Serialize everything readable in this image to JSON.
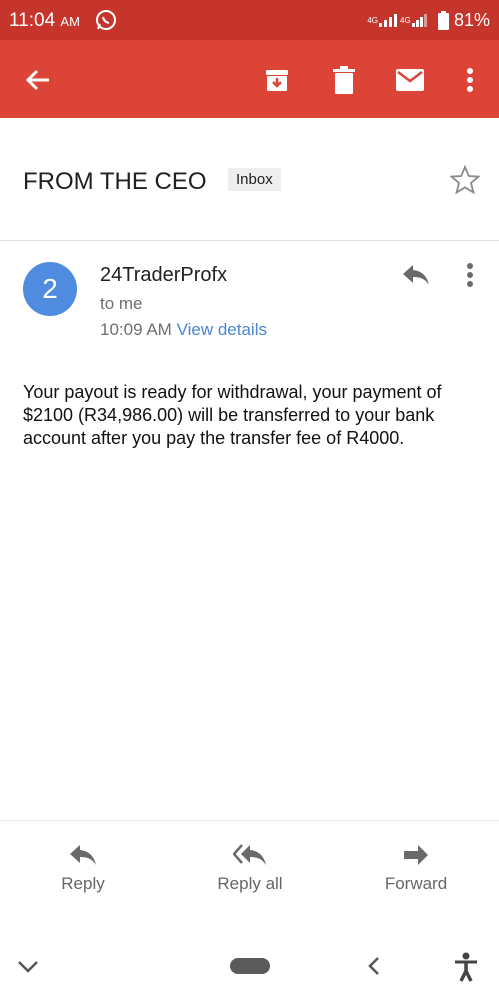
{
  "status": {
    "time": "11:04",
    "ampm": "AM",
    "network1": "4G",
    "network2": "4G",
    "battery": "81%"
  },
  "toolbar": {
    "back_icon": "arrow-left-icon",
    "archive_icon": "archive-icon",
    "delete_icon": "trash-icon",
    "mark_unread_icon": "mail-icon",
    "more_icon": "more-vert-icon"
  },
  "email": {
    "subject": "FROM THE CEO",
    "label": "Inbox",
    "avatar_text": "2",
    "sender": "24TraderProfx",
    "recipient": "to me",
    "time": "10:09 AM",
    "view_details": "View details",
    "body": "Your payout is ready for withdrawal, your payment of $2100 (R34,986.00) will be transferred to your bank account after you pay the transfer fee of R4000."
  },
  "actions": {
    "reply": "Reply",
    "reply_all": "Reply all",
    "forward": "Forward"
  },
  "colors": {
    "status_bar": "#c6352c",
    "app_bar": "#db4437",
    "avatar": "#4f8bdf",
    "link": "#4a86d3"
  }
}
